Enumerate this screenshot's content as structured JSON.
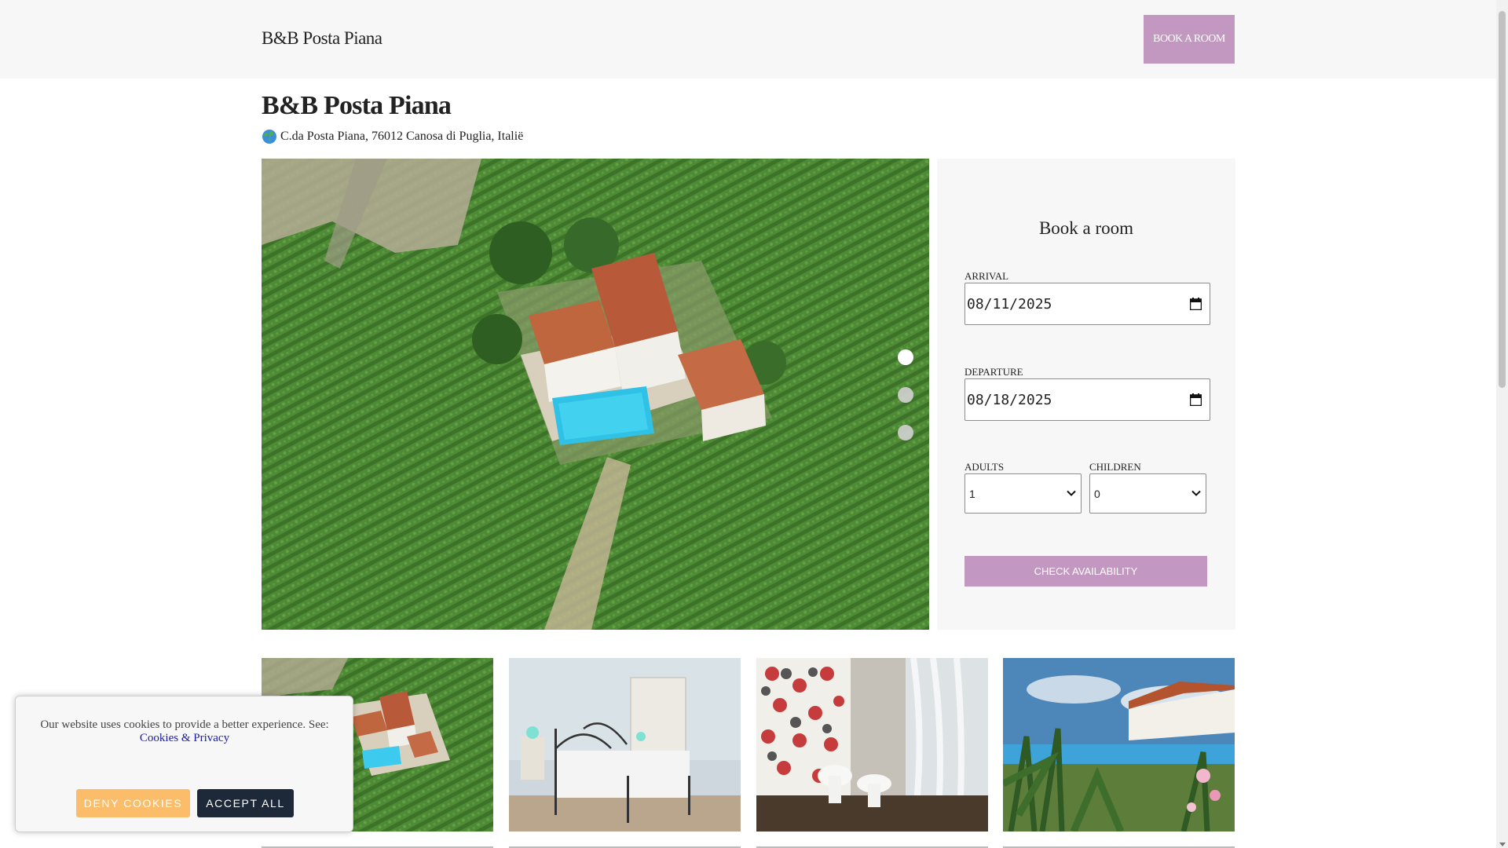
{
  "header": {
    "brand": "B&B Posta Piana",
    "book_button": "BOOK A ROOM"
  },
  "main": {
    "title": "B&B Posta Piana",
    "address_icon": "globe-icon",
    "address": "C.da Posta Piana, 76012 Canosa di Puglia, Italië"
  },
  "carousel": {
    "slides_count": 3,
    "active_slide": 1
  },
  "booking": {
    "title": "Book a room",
    "arrival_label": "ARRIVAL",
    "arrival_value": "08/11/2025",
    "departure_label": "DEPARTURE",
    "departure_value": "08/18/2025",
    "adults_label": "ADULTS",
    "adults_value": "1",
    "children_label": "CHILDREN",
    "children_value": "0",
    "check_button": "CHECK AVAILABILITY"
  },
  "cookie": {
    "text": "Our website uses cookies to provide a better experience. See:",
    "link": "Cookies & Privacy",
    "deny": "DENY COOKIES",
    "accept": "ACCEPT ALL"
  },
  "colors": {
    "accent": "#c297c0",
    "deny": "#fbbd6a",
    "accept": "#1d2939",
    "panel": "#f7f7f7"
  }
}
